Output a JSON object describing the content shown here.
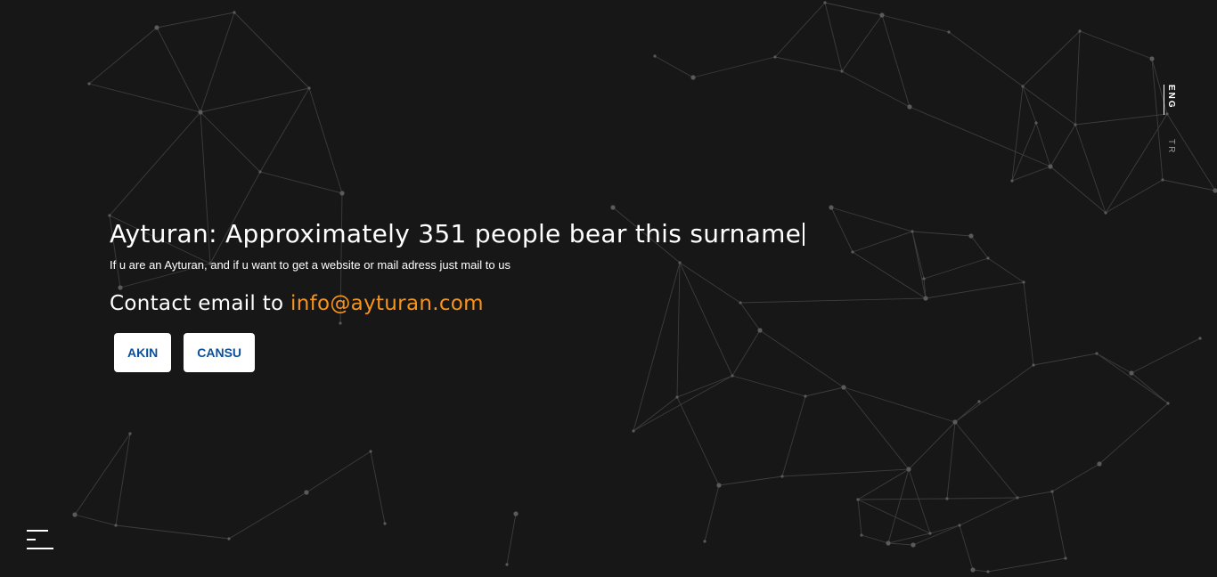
{
  "hero": {
    "headline": "Ayturan: Approximately 351 people bear this surname",
    "subtext": "If u are an Ayturan, and if u want to get a website or mail adress just mail to us",
    "contact_prefix": "Contact email to ",
    "contact_email": "info@ayturan.com"
  },
  "buttons": [
    {
      "label": "AKIN"
    },
    {
      "label": "CANSU"
    }
  ],
  "language": {
    "active": "ENG",
    "other": "TR"
  },
  "menu": {
    "icon": "hamburger-menu-icon"
  },
  "colors": {
    "background": "#171717",
    "accent": "#f7941d",
    "button_text": "#0a4f9c"
  }
}
